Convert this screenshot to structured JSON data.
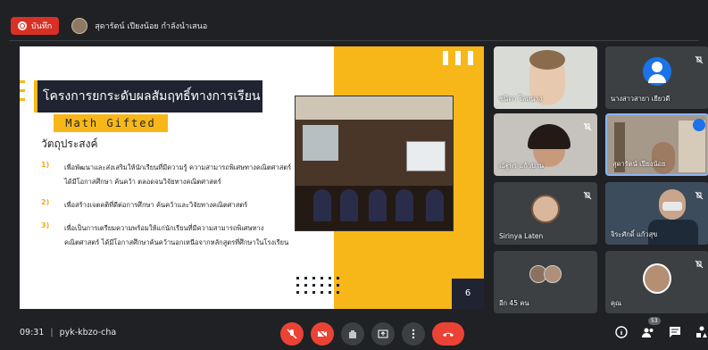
{
  "topbar": {
    "record_label": "บันทึก",
    "presenter_text": "สุดารัตน์ เปียงน้อย กำลังนำเสนอ"
  },
  "slide": {
    "title": "โครงการยกระดับผลสัมฤทธิ์ทางการเรียน",
    "subtitle": "Math Gifted",
    "objectives_heading": "วัตถุประสงค์",
    "objectives": [
      {
        "num": "1)",
        "text": "เพื่อพัฒนาและส่งเสริมให้นักเรียนที่มีความรู้ ความสามารถพิเศษทางคณิตศาสตร์ได้มีโอกาสศึกษา ค้นคว้า ตลอดจนวิจัยทางคณิตศาสตร์"
      },
      {
        "num": "2)",
        "text": "เพื่อสร้างเจตคติที่ดีต่อการศึกษา ค้นคว้าและวิจัยทางคณิตศาสตร์"
      },
      {
        "num": "3)",
        "text": "เพื่อเป็นการเตรียมความพร้อมให้แก่นักเรียนที่มีความสามารถพิเศษทางคณิตศาสตร์ ได้มีโอกาสศึกษาค้นคว้านอกเหนือจากหลักสูตรที่ศึกษาในโรงเรียน"
      }
    ],
    "page_number": "6"
  },
  "participants": [
    {
      "name": "ชนิดา โลหนาง",
      "muted": false
    },
    {
      "name": "นางสาวสายา เยียวดี",
      "muted": true
    },
    {
      "name": "ณัฐพร แก้วปาน",
      "muted": true
    },
    {
      "name": "สุดารัตน์ เปียงน้อย",
      "muted": false
    },
    {
      "name": "Sirinya Laten",
      "muted": true
    },
    {
      "name": "จิระศักดิ์ แก้วสุข",
      "muted": true
    },
    {
      "name": "อีก 45 คน",
      "muted": false
    },
    {
      "name": "คุณ",
      "muted": true
    }
  ],
  "bottombar": {
    "time": "09:31",
    "meeting_code": "pyk-kbzo-cha",
    "people_count": "53"
  },
  "icons": [
    "record-icon",
    "mic-off-icon",
    "camera-off-icon",
    "raise-hand-icon",
    "present-icon",
    "more-icon",
    "hangup-icon",
    "info-icon",
    "people-icon",
    "chat-icon",
    "activities-icon"
  ],
  "colors": {
    "accent_yellow": "#f7b718",
    "dark_navy": "#202331",
    "meet_red": "#ea4335",
    "meet_bg": "#202124"
  }
}
